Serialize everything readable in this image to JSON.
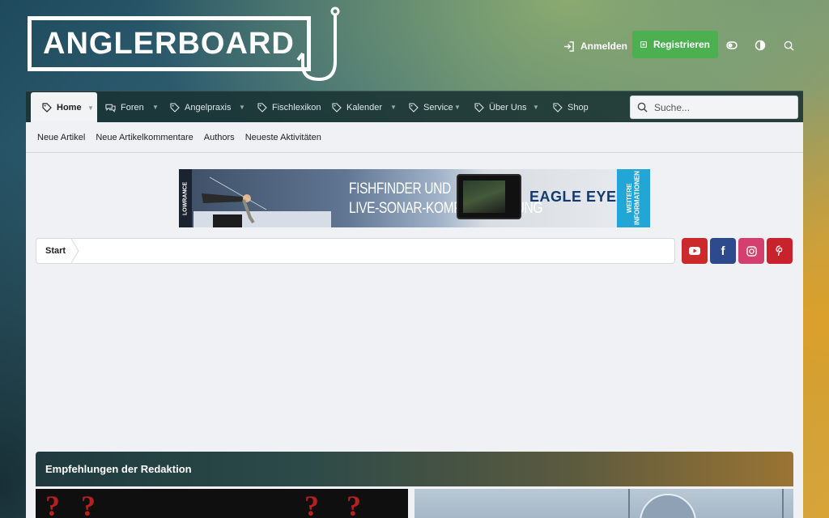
{
  "header": {
    "logo_text": "ANGLERBOARD",
    "login_label": "Anmelden",
    "register_label": "Registrieren"
  },
  "nav": {
    "tabs": [
      {
        "label": "Home",
        "icon": "tag-icon",
        "active": true,
        "dropdown": true
      },
      {
        "label": "Foren",
        "icon": "comments-icon",
        "active": false,
        "dropdown": true
      },
      {
        "label": "Angelpraxis",
        "icon": "tag-icon",
        "active": false,
        "dropdown": true
      },
      {
        "label": "Fischlexikon",
        "icon": "tag-icon",
        "active": false,
        "dropdown": false
      },
      {
        "label": "Kalender",
        "icon": "tag-icon",
        "active": false,
        "dropdown": true
      },
      {
        "label": "Service",
        "icon": "tag-icon",
        "active": false,
        "dropdown": true
      },
      {
        "label": "Über Uns",
        "icon": "tag-icon",
        "active": false,
        "dropdown": true
      },
      {
        "label": "Shop",
        "icon": "tag-icon",
        "active": false,
        "dropdown": false
      }
    ],
    "search_placeholder": "Suche..."
  },
  "subnav": {
    "items": [
      "Neue Artikel",
      "Neue Artikelkommentare",
      "Authors",
      "Neueste Aktivitäten"
    ]
  },
  "banner": {
    "brand": "LOWRANCE",
    "line1": "FISHFINDER UND",
    "line2": "LIVE-SONAR-KOMPLETTLÖSUNG",
    "product": "EAGLE EYE",
    "product_mark": "™",
    "cta": "WEITERE INFORMATIONEN"
  },
  "breadcrumb": {
    "start_label": "Start"
  },
  "social": [
    {
      "name": "youtube",
      "color": "#cc2a2a"
    },
    {
      "name": "facebook",
      "color": "#2d4a8c"
    },
    {
      "name": "instagram",
      "color": "#d3406f"
    },
    {
      "name": "pinterest",
      "color": "#c8232c"
    }
  ],
  "picks": {
    "title": "Empfehlungen der Redaktion"
  },
  "colors": {
    "register": "#4caf50",
    "nav_bg": "#193232",
    "main_bg": "#eff1f4"
  }
}
